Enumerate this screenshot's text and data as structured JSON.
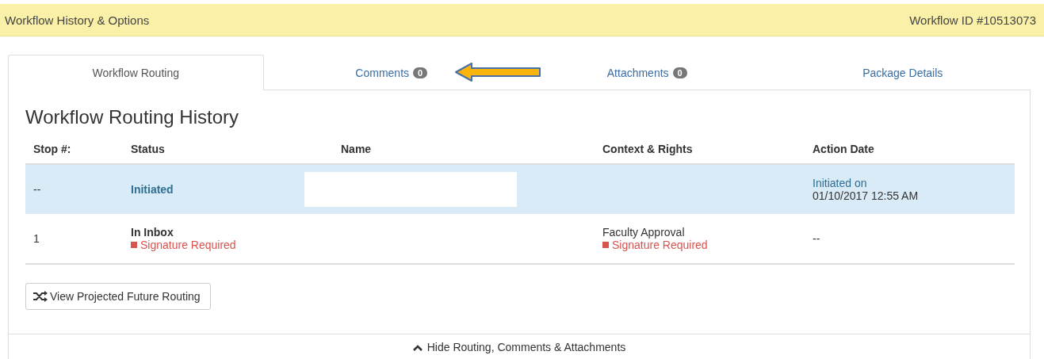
{
  "header": {
    "title": "Workflow History & Options",
    "workflow_id": "Workflow ID #10513073"
  },
  "tabs": [
    {
      "label": "Workflow Routing",
      "selected": true
    },
    {
      "label": "Comments",
      "badge": "0",
      "selected": false,
      "arrow": true
    },
    {
      "label": "Attachments",
      "badge": "0",
      "selected": false
    },
    {
      "label": "Package Details",
      "selected": false
    }
  ],
  "section_title": "Workflow Routing History",
  "table": {
    "columns": [
      "Stop #:",
      "Status",
      "Name",
      "Context & Rights",
      "Action Date"
    ],
    "rows": [
      {
        "highlighted": true,
        "stop": "--",
        "status": "Initiated",
        "name_redacted": true,
        "action_label": "Initiated on",
        "action_value": "01/10/2017 12:55 AM"
      },
      {
        "highlighted": false,
        "stop": "1",
        "status": "In Inbox",
        "status_note": "Signature Required",
        "name_redacted": false,
        "context": "Faculty Approval",
        "context_note": "Signature Required",
        "action_value": "--"
      }
    ]
  },
  "future_button": "View Projected Future Routing",
  "footer_link": "Hide Routing, Comments & Attachments"
}
